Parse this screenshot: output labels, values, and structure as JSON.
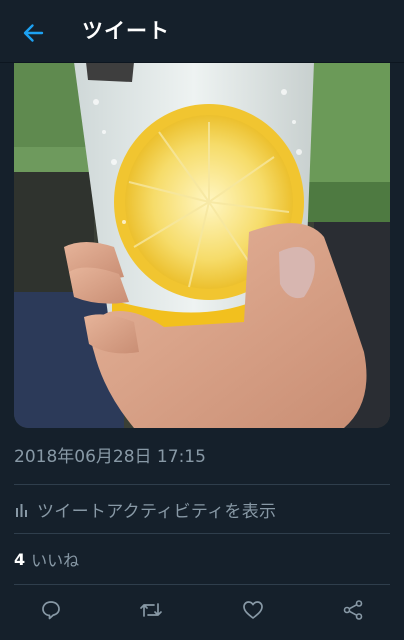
{
  "header": {
    "title": "ツイート",
    "back_icon": "back-arrow-icon"
  },
  "tweet": {
    "media": {
      "icon": "photo-of-lemon-slice-in-glass"
    },
    "timestamp": "2018年06月28日 17:15",
    "activity": {
      "icon": "bar-chart-icon",
      "label": "ツイートアクティビティを表示"
    },
    "likes": {
      "count": "4",
      "label": "いいね"
    }
  },
  "actions": [
    {
      "name": "reply",
      "icon": "reply-icon"
    },
    {
      "name": "retweet",
      "icon": "retweet-icon"
    },
    {
      "name": "like",
      "icon": "heart-icon"
    },
    {
      "name": "share",
      "icon": "share-icon"
    }
  ],
  "colors": {
    "background": "#15202b",
    "accent": "#1da1f2",
    "secondary_text": "#8899a6",
    "divider": "#2f3e4c"
  }
}
